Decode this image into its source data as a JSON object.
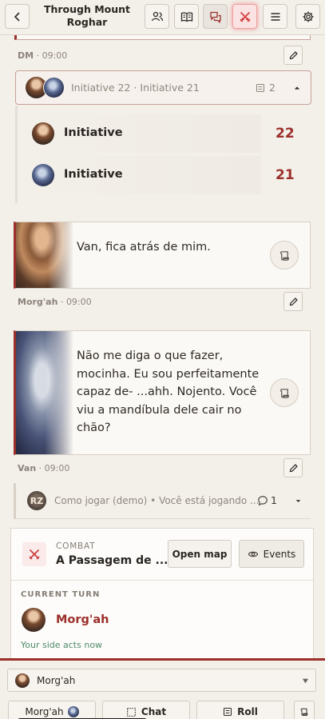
{
  "header": {
    "title_line1": "Through Mount",
    "title_line2": "Roghar"
  },
  "initiative_block": {
    "author": "DM",
    "time": "09:00",
    "summary": "Initiative 22 · Initiative 21",
    "count": "2",
    "rows": [
      {
        "label": "Initiative",
        "value": "22"
      },
      {
        "label": "Initiative",
        "value": "21"
      }
    ]
  },
  "messages": [
    {
      "text_lines": [
        "Van, fica atrás de mim."
      ],
      "author": "Morg'ah",
      "time": "09:00"
    },
    {
      "text_lines": [
        "Não me diga o que fazer,",
        "mocinha. Eu sou perfeitamente",
        "capaz de- ...ahh. Nojento. Você",
        "viu a mandíbula dele cair no",
        "chão?"
      ],
      "author": "Van",
      "time": "09:00"
    }
  ],
  "thread": {
    "avatar_text": "RZ",
    "preview": "Como jogar (demo) • Você está jogando ...",
    "replies": "1"
  },
  "combat": {
    "label": "COMBAT",
    "name": "A Passagem de ...",
    "open_map": "Open map",
    "events": "Events",
    "current_turn_label": "CURRENT TURN",
    "current_name": "Morg'ah",
    "side_note": "Your side acts now"
  },
  "composer": {
    "speaker": "Morg'ah",
    "tabs": [
      "Morg'ah",
      "Chat",
      "Roll"
    ]
  },
  "colors": {
    "accent": "#9b2f2a",
    "background": "#f3efe9",
    "green_note": "#4f8a69"
  }
}
